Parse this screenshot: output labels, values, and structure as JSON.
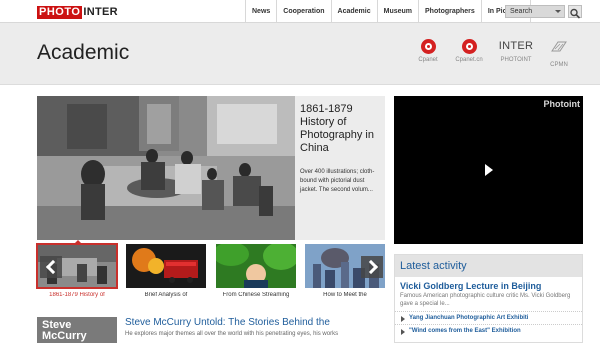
{
  "brand": {
    "logo_part1": "PHOTO",
    "logo_part2": "INTER"
  },
  "nav": {
    "items": [
      "News",
      "Cooperation",
      "Academic",
      "Museum",
      "Photographers",
      "In Pictures"
    ],
    "search_value": "Search"
  },
  "header": {
    "title": "Academic",
    "partners": [
      {
        "label": "Cpanet",
        "icon": "cpanet-logo-icon"
      },
      {
        "label": "Cpanet.cn",
        "icon": "cpanet-logo-icon"
      },
      {
        "label": "PHOTOINT",
        "mark": "INTER"
      },
      {
        "label": "CPMN",
        "icon": "cpmn-logo-icon"
      }
    ]
  },
  "feature": {
    "title": "1861-1879 History of Photography in China",
    "description": "Over 400 illustrations; cloth-bound with pictorial dust jacket. The second volum..."
  },
  "video": {
    "brand": "Photoint"
  },
  "thumbnails": [
    {
      "caption": "1861-1879 History of",
      "active": true
    },
    {
      "caption": "Brief Analysis of",
      "active": false
    },
    {
      "caption": "From Chinese Streaming",
      "active": false
    },
    {
      "caption": "How to Meet the",
      "active": false
    }
  ],
  "article": {
    "thumb_text_1": "Steve",
    "thumb_text_2": "McCurry",
    "title": "Steve McCurry Untold: The Stories Behind the",
    "text": "He explores major themes all over the world with his penetrating eyes, his works"
  },
  "activity": {
    "header": "Latest activity",
    "lead_title": "Vicki Goldberg Lecture in Beijing",
    "lead_text": "Famous American photographic culture critic Ms. Vicki Goldberg gave a special le...",
    "items": [
      "Yang Jianchuan Photographic Art Exhibiti",
      "\"Wind comes from the East\" Exhibition"
    ]
  },
  "colors": {
    "accent": "#c9302c",
    "link": "#1f5d9b"
  }
}
